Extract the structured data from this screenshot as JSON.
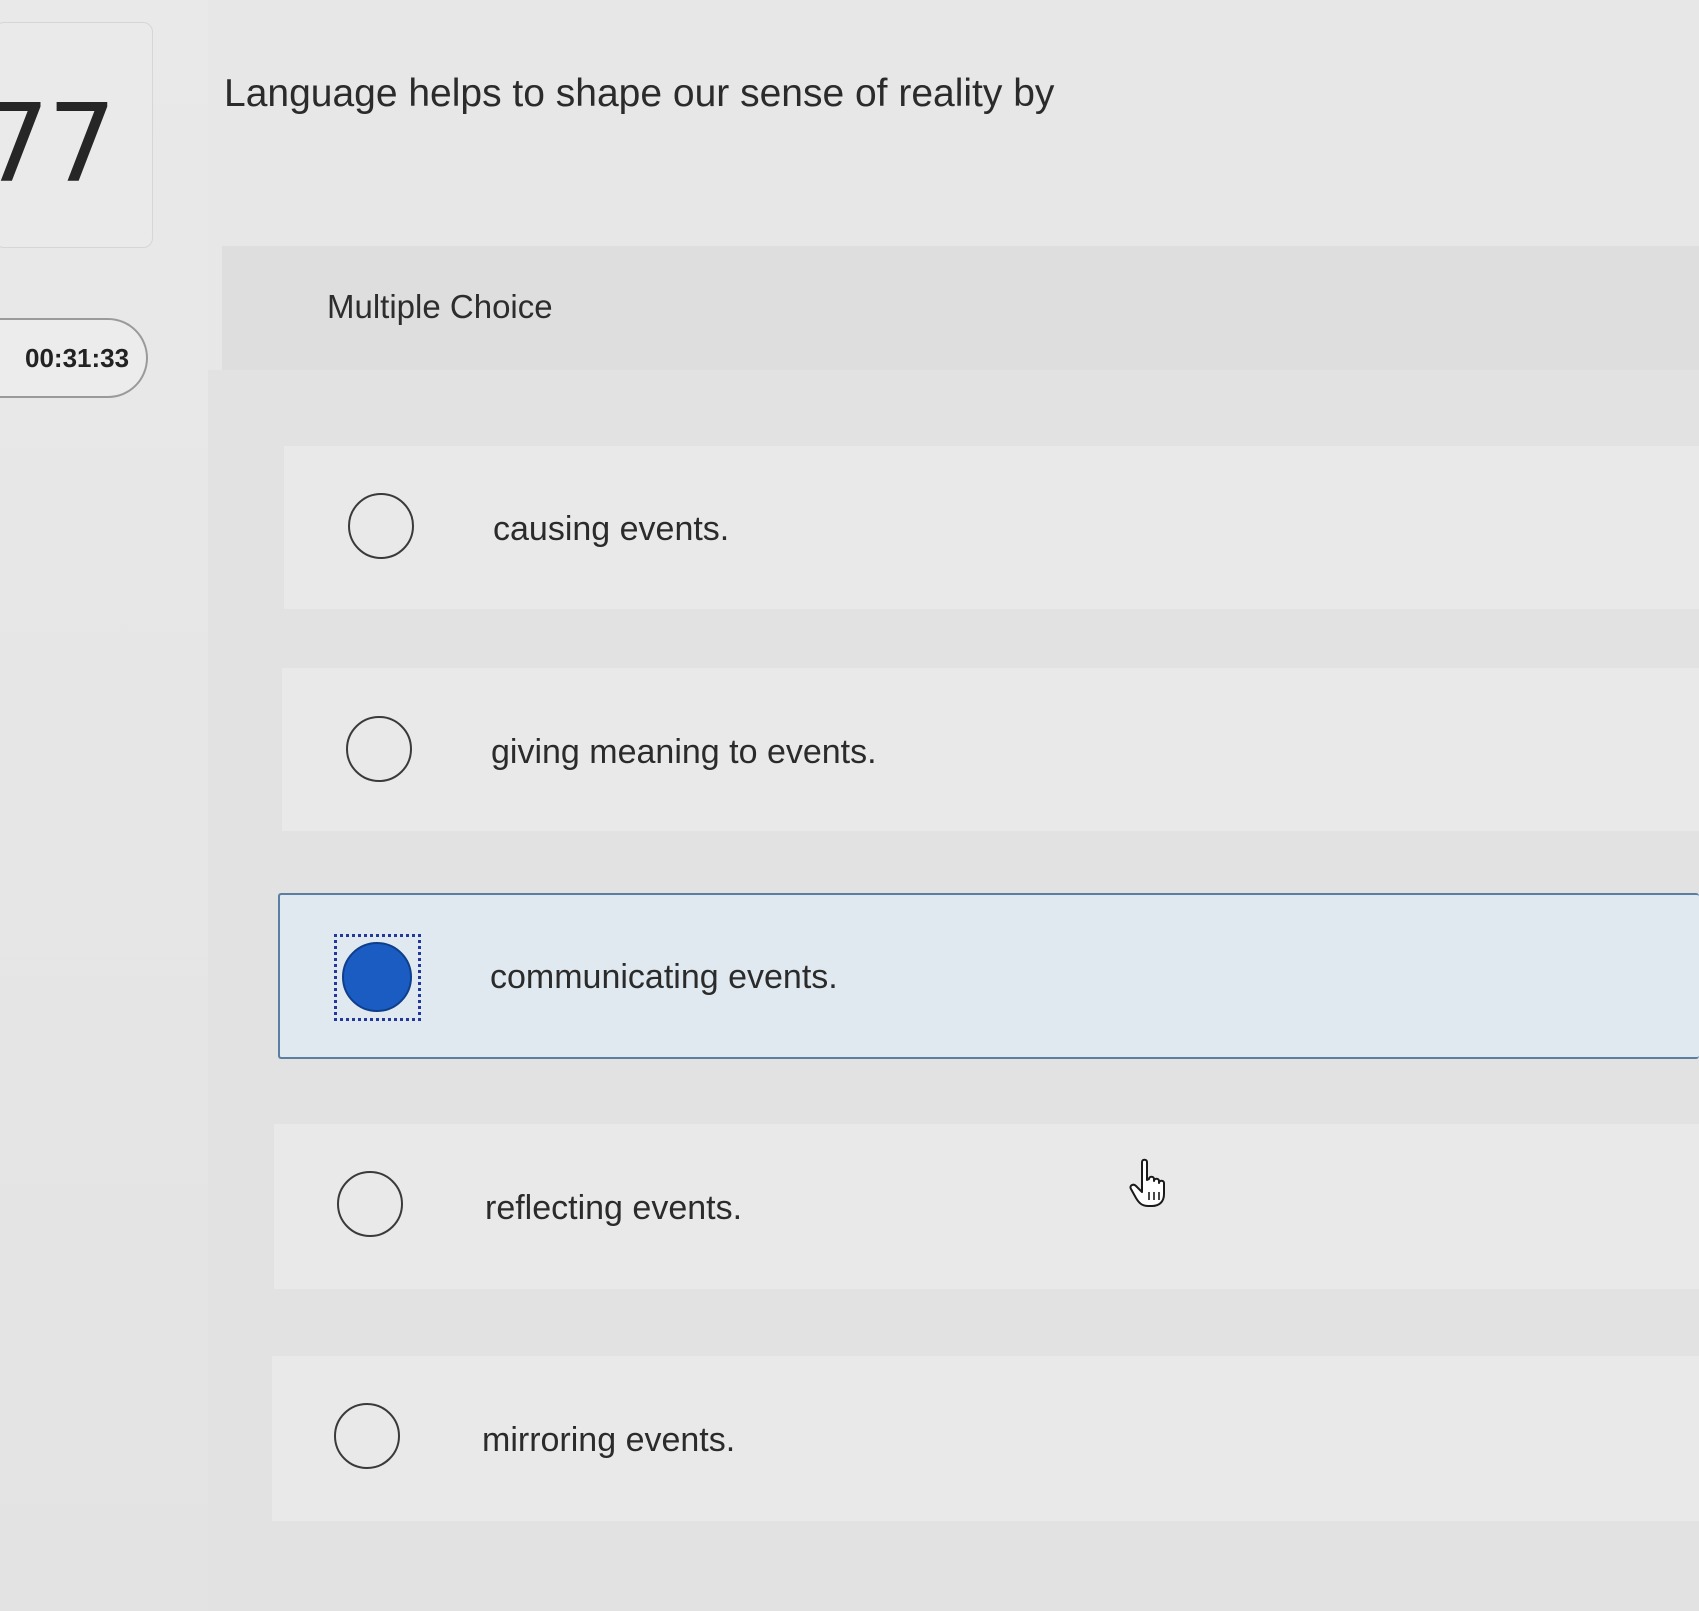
{
  "question_number": "77",
  "timer": "00:31:33",
  "question": {
    "text": "Language helps to shape our sense of reality by"
  },
  "question_type": "Multiple Choice",
  "choices": [
    {
      "label": "causing events.",
      "selected": false
    },
    {
      "label": "giving meaning to events.",
      "selected": false
    },
    {
      "label": "communicating events.",
      "selected": true
    },
    {
      "label": "reflecting events.",
      "selected": false
    },
    {
      "label": "mirroring events.",
      "selected": false
    }
  ],
  "colors": {
    "selected_fill": "#1b5cc2",
    "selected_background": "#e0e9ef",
    "selected_border": "#5a7fa3"
  },
  "icons": {
    "cursor": "hand-pointer-icon"
  }
}
